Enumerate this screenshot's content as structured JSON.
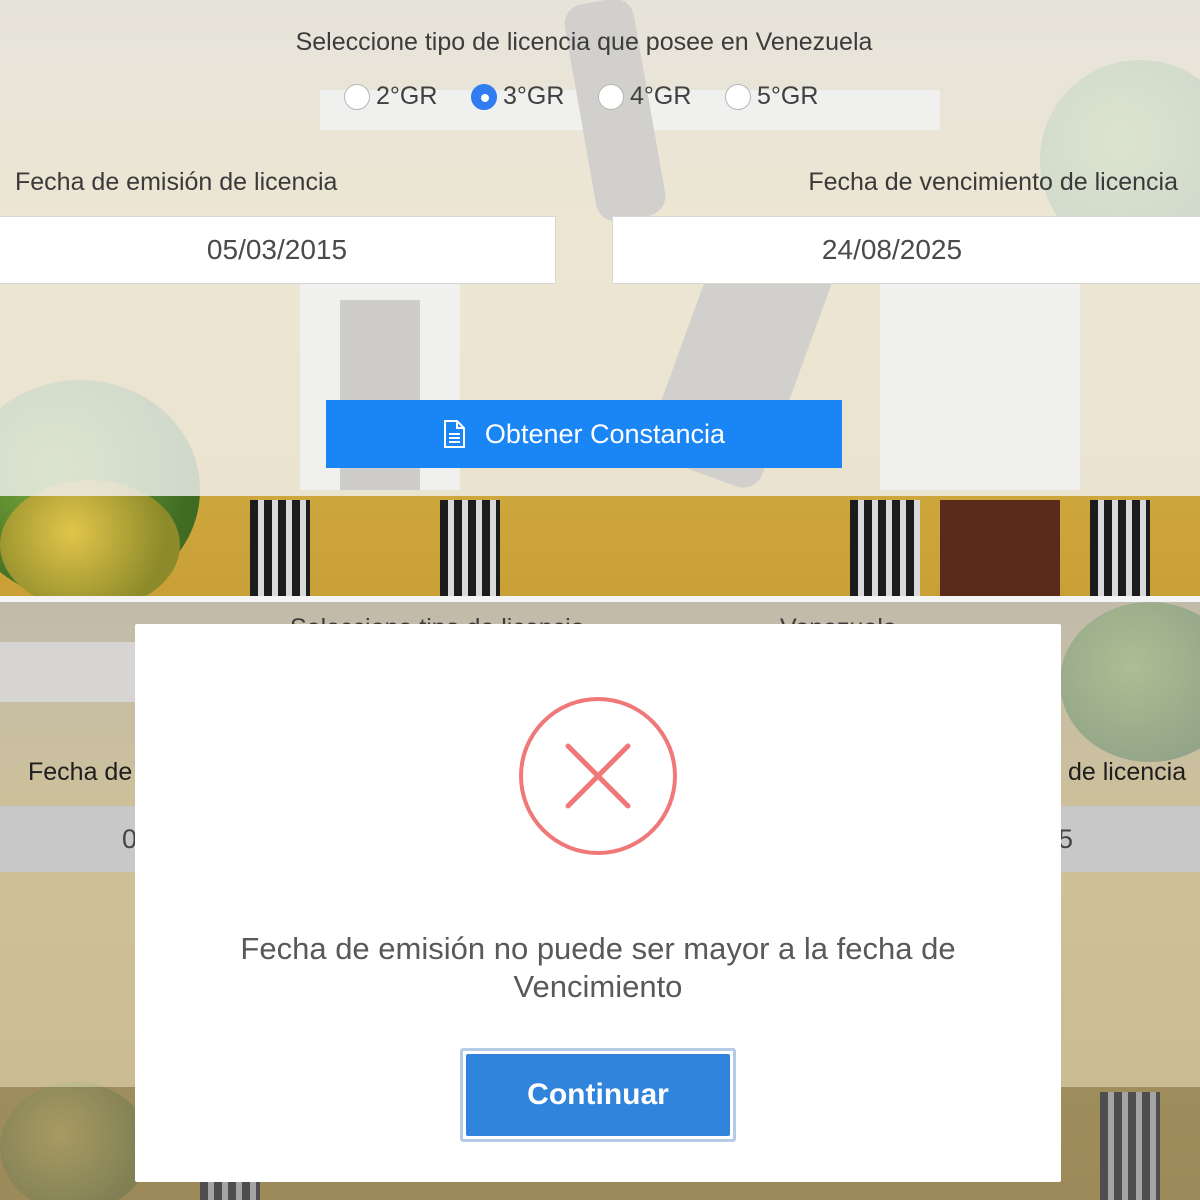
{
  "form": {
    "title": "Seleccione tipo de licencia que posee en Venezuela",
    "license_options": [
      {
        "label": "2°GR",
        "selected": false
      },
      {
        "label": "3°GR",
        "selected": true
      },
      {
        "label": "4°GR",
        "selected": false
      },
      {
        "label": "5°GR",
        "selected": false
      }
    ],
    "issue_date_label": "Fecha de emisión de licencia",
    "issue_date_value": "05/03/2015",
    "expiry_date_label": "Fecha de vencimiento de licencia",
    "expiry_date_value": "24/08/2025",
    "submit_label": "Obtener Constancia",
    "submit_icon": "document-icon"
  },
  "background_fragments": {
    "title_left": "Seleccione tipo de licencia",
    "title_right": "Venezuela",
    "issue_label_fragment": "Fecha de",
    "expiry_label_fragment": "de licencia",
    "issue_value_fragment": "0",
    "expiry_value_fragment": "5"
  },
  "modal": {
    "icon": "error-x-icon",
    "message_line1": "Fecha de emisión no puede ser mayor a la fecha de",
    "message_line2": "Vencimiento",
    "confirm_label": "Continuar"
  },
  "colors": {
    "primary_button": "#1a86f5",
    "radio_selected": "#2f7df0",
    "error_icon": "#f07878",
    "confirm_button": "#3084db"
  }
}
